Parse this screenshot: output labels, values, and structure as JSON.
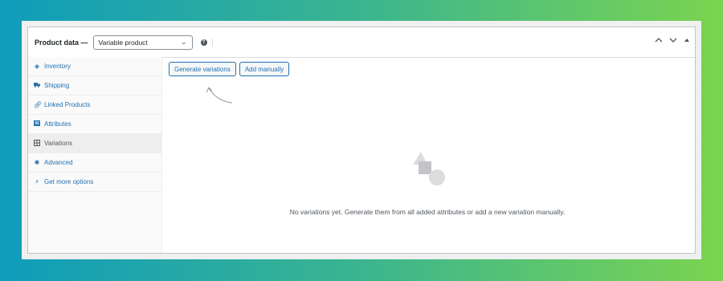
{
  "header": {
    "title": "Product data —",
    "product_type": "Variable product"
  },
  "sidebar": {
    "items": [
      {
        "label": "Inventory",
        "icon": "tag-icon"
      },
      {
        "label": "Shipping",
        "icon": "truck-icon"
      },
      {
        "label": "Linked Products",
        "icon": "link-icon"
      },
      {
        "label": "Attributes",
        "icon": "list-icon"
      },
      {
        "label": "Variations",
        "icon": "grid-icon",
        "active": true
      },
      {
        "label": "Advanced",
        "icon": "gear-icon"
      },
      {
        "label": "Get more options",
        "icon": "plugin-icon"
      }
    ]
  },
  "main": {
    "generate_label": "Generate variations",
    "add_manually_label": "Add manually",
    "empty_message": "No variations yet. Generate them from all added attributes or add a new variation manually."
  },
  "colors": {
    "link": "#2271b1",
    "border": "#c3c4c7"
  }
}
